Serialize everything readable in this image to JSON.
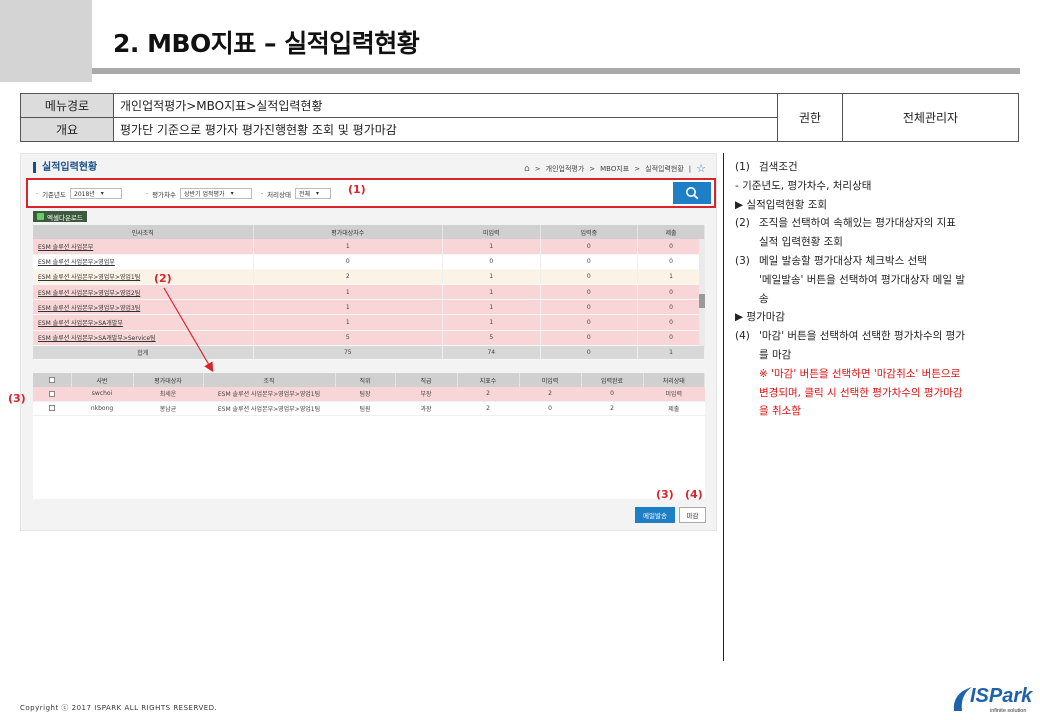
{
  "slide": {
    "title": "2. MBO지표 – 실적입력현황",
    "copyright": "Copyright ⓒ 2017 ISPARK ALL RIGHTS RESERVED.",
    "logo_text": "ISPark",
    "logo_sub": "infinite solution"
  },
  "info": {
    "menu_label": "메뉴경로",
    "menu_value": "개인업적평가>MBO지표>실적입력현황",
    "summary_label": "개요",
    "summary_value": "평가단 기준으로 평가자 평가진행현황 조회 및 평가마감",
    "auth_label": "권한",
    "auth_value": "전체관리자"
  },
  "screen": {
    "page_title": "실적입력현황",
    "breadcrumb": [
      "개인업적평가",
      "MBO지표",
      "실적입력현황"
    ],
    "filters": {
      "year_label": "기준년도",
      "year_value": "2018년",
      "round_label": "평가차수",
      "round_value": "상반기 업적평가",
      "status_label": "처리상태",
      "status_value": "전체"
    },
    "excel_button": "엑셀다운로드",
    "grid1": {
      "headers": [
        "인사조직",
        "평가대상자수",
        "미입력",
        "입력중",
        "제출"
      ],
      "rows": [
        {
          "org": "ESM 솔루션 사업본부",
          "v": [
            "1",
            "1",
            "0",
            "0"
          ],
          "style": "pink"
        },
        {
          "org": "ESM 솔루션 사업본부>영업부",
          "v": [
            "0",
            "0",
            "0",
            "0"
          ],
          "style": "plain"
        },
        {
          "org": "ESM 솔루션 사업본부>영업부>영업1팀",
          "v": [
            "2",
            "1",
            "0",
            "1"
          ],
          "style": "hl"
        },
        {
          "org": "ESM 솔루션 사업본부>영업부>영업2팀",
          "v": [
            "1",
            "1",
            "0",
            "0"
          ],
          "style": "pink"
        },
        {
          "org": "ESM 솔루션 사업본부>영업부>영업3팀",
          "v": [
            "1",
            "1",
            "0",
            "0"
          ],
          "style": "pink"
        },
        {
          "org": "ESM 솔루션 사업본부>SA개발부",
          "v": [
            "1",
            "1",
            "0",
            "0"
          ],
          "style": "pink"
        },
        {
          "org": "ESM 솔루션 사업본부>SA개발부>Service팀",
          "v": [
            "5",
            "5",
            "0",
            "0"
          ],
          "style": "pink"
        }
      ],
      "total": {
        "label": "합계",
        "v": [
          "75",
          "74",
          "0",
          "1"
        ]
      }
    },
    "grid2": {
      "headers": [
        "",
        "사번",
        "평가대상자",
        "조직",
        "직위",
        "직급",
        "지표수",
        "미입력",
        "입력완료",
        "처리상태"
      ],
      "rows": [
        {
          "id": "swchoi",
          "name": "최세운",
          "org": "ESM 솔루션 사업본부>영업부>영업1팀",
          "pos": "팀장",
          "grade": "부장",
          "cnt": "2",
          "none": "2",
          "done": "0",
          "status": "미입력",
          "style": "pink"
        },
        {
          "id": "nkbong",
          "name": "봉남균",
          "org": "ESM 솔루션 사업본부>영업부>영업1팀",
          "pos": "팀원",
          "grade": "과장",
          "cnt": "2",
          "none": "0",
          "done": "2",
          "status": "제출",
          "style": "plain"
        }
      ]
    },
    "mail_button": "메일발송",
    "close_button": "마감",
    "callouts": {
      "c1": "(1)",
      "c2": "(2)",
      "c3a": "(3)",
      "c3b": "(3)",
      "c4": "(4)"
    }
  },
  "notes": {
    "n1_num": "(1)",
    "n1": "검색조건",
    "n1_sub": "- 기준년도, 평가차수, 처리상태",
    "s1": "▶ 실적입력현황 조회",
    "n2_num": "(2)",
    "n2": "조직을 선택하여 속해있는 평가대상자의 지표",
    "n2_b": "실적 입력현황 조회",
    "n3_num": "(3)",
    "n3": "메일 발송할 평가대상자 체크박스 선택",
    "n3_b": "'메일발송' 버튼을 선택하여 평가대상자 메일 발",
    "n3_c": "송",
    "s2": "▶ 평가마감",
    "n4_num": "(4)",
    "n4": "'마감' 버튼을 선택하여 선택한 평가차수의 평가",
    "n4_b": "를 마감",
    "r1": "※ '마감' 버튼을 선택하면 '마감취소' 버튼으로",
    "r2": "변경되며, 클릭 시 선택한 평가차수의 평가마감",
    "r3": "을 취소함"
  }
}
